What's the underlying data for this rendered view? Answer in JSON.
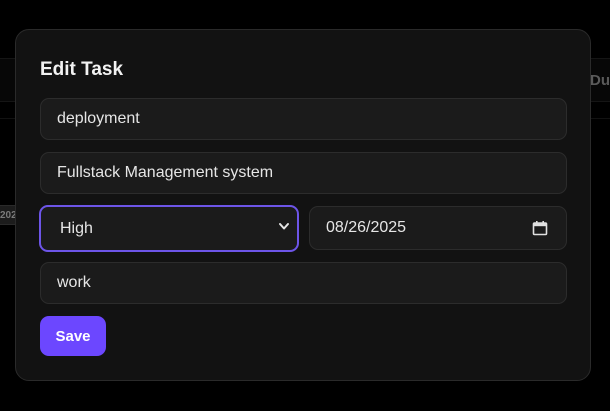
{
  "background": {
    "header_fragment": "Du",
    "date_fragment": "202"
  },
  "modal": {
    "title": "Edit Task",
    "fields": {
      "name": "deployment",
      "description": "Fullstack Management system",
      "priority": "High",
      "due_date": "08/26/2025",
      "category": "work"
    },
    "save_label": "Save"
  },
  "colors": {
    "accent": "#6c47ff",
    "focus_border": "#6d55e8",
    "modal_bg": "#121212",
    "field_bg": "#1b1b1b"
  },
  "icons": {
    "priority_dropdown": "chevron-down-icon",
    "date_picker": "calendar-icon"
  }
}
